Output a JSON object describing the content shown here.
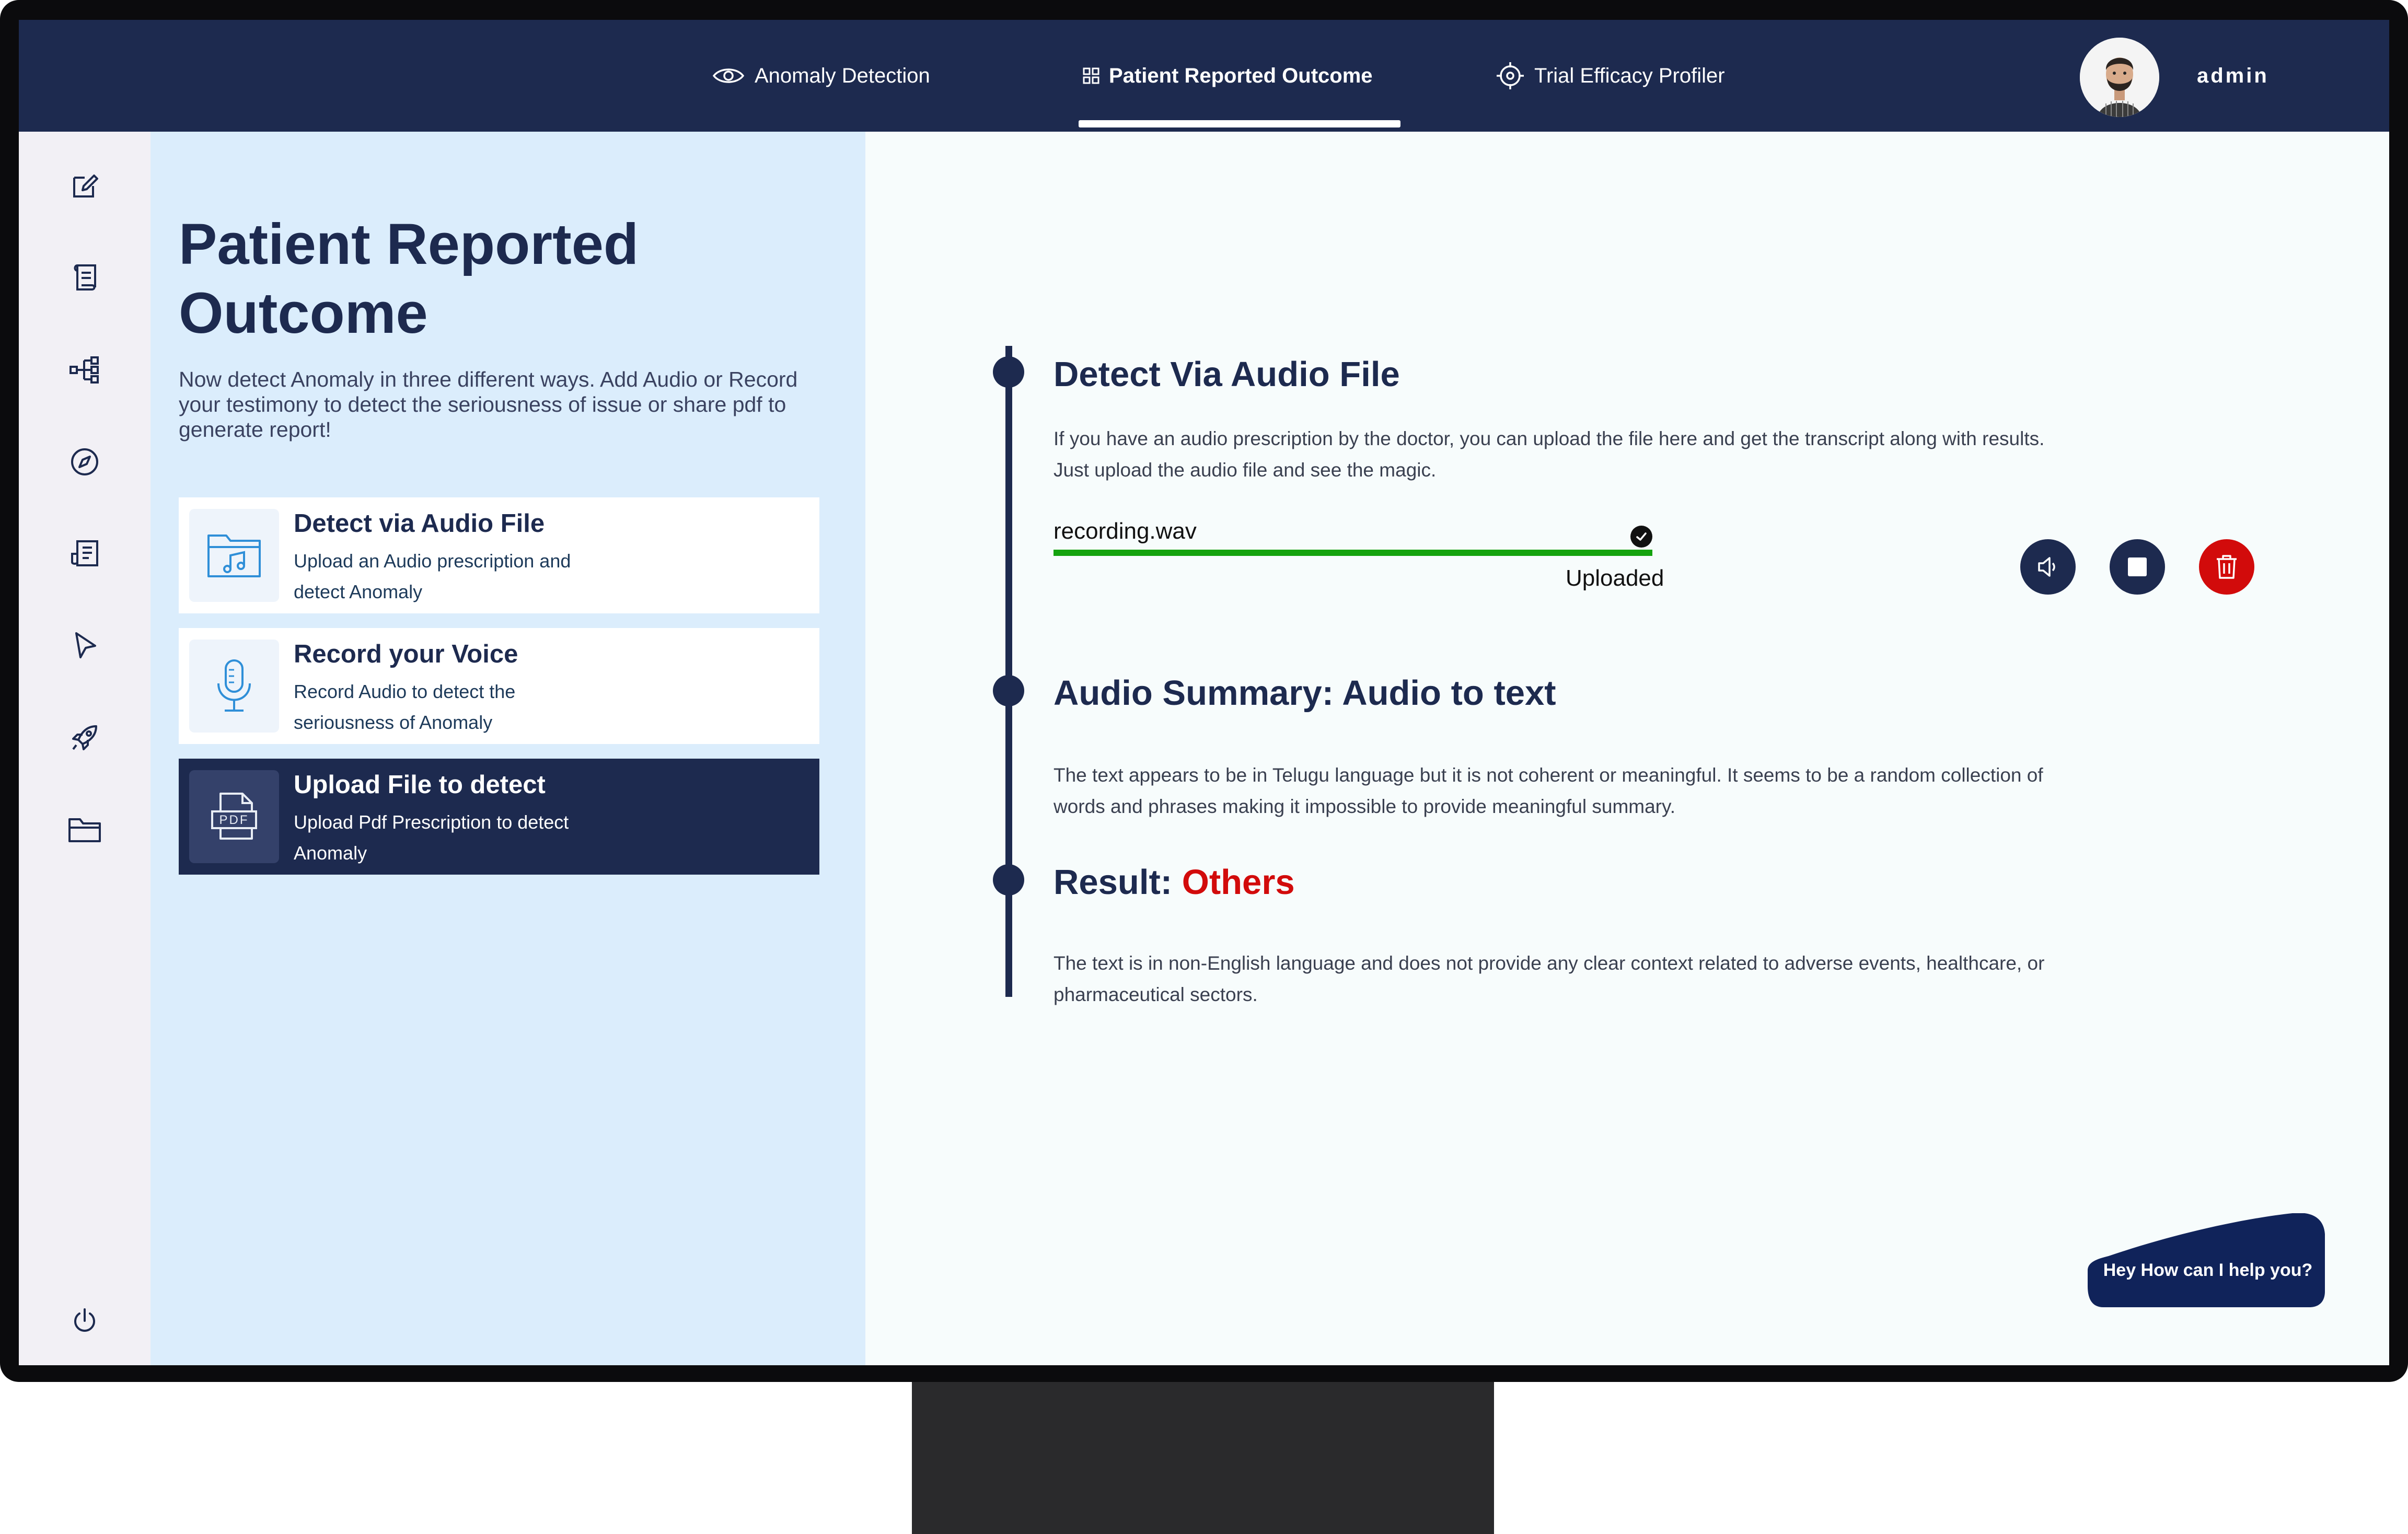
{
  "nav": {
    "tabs": [
      {
        "label": "Anomaly Detection",
        "icon": "eye-icon"
      },
      {
        "label": "Patient Reported Outcome",
        "icon": "grid-icon",
        "active": true
      },
      {
        "label": "Trial Efficacy Profiler",
        "icon": "crosshair-icon"
      }
    ],
    "user": {
      "name": "admin",
      "avatar": "avatar"
    }
  },
  "sidebar": {
    "icons": [
      "edit-icon",
      "scroll-icon",
      "hierarchy-icon",
      "compass-icon",
      "document-icon",
      "cursor-icon",
      "rocket-icon",
      "folder-icon",
      "power-icon"
    ]
  },
  "panel": {
    "title": "Patient Reported Outcome",
    "description": "Now detect Anomaly in three different ways. Add Audio or Record your testimony to detect the seriousness of issue or share pdf to generate report!",
    "options": [
      {
        "title": "Detect via Audio File",
        "description": "Upload an Audio prescription and detect Anomaly",
        "icon": "music-folder-icon",
        "selected": false
      },
      {
        "title": "Record your Voice",
        "description": "Record Audio to detect the seriousness of Anomaly",
        "icon": "microphone-icon",
        "selected": false
      },
      {
        "title": "Upload File to detect",
        "description": "Upload Pdf Prescription to detect Anomaly",
        "icon": "pdf-icon",
        "icon_text": "PDF",
        "selected": true
      }
    ]
  },
  "main": {
    "detect": {
      "title": "Detect Via Audio File",
      "description": "If you have an audio prescription by the doctor, you can upload the file here and get the transcript along with results. Just upload the audio file and see the magic."
    },
    "upload": {
      "file_name": "recording.wav",
      "status": "Uploaded",
      "progress": 100,
      "progress_color": "#15a30f"
    },
    "controls": [
      {
        "name": "speaker-button",
        "icon": "speaker-icon"
      },
      {
        "name": "stop-button",
        "icon": "stop-icon"
      },
      {
        "name": "delete-button",
        "icon": "trash-icon"
      }
    ],
    "summary": {
      "title": "Audio Summary: Audio to text",
      "text": "The text appears to be in Telugu language but it is not coherent or meaningful. It seems to be a random collection  of words and phrases making it impossible to provide  meaningful summary."
    },
    "result": {
      "label": "Result: ",
      "value": "Others",
      "value_color": "#d20b0b",
      "text": "The text is in  non-English language and does not provide any clear context related to adverse events, healthcare, or pharmaceutical sectors."
    }
  },
  "chat": {
    "label": "Hey How can I help you?"
  },
  "colors": {
    "navy": "#1d2a4f",
    "panel": "#dbedfc",
    "accent_red": "#d20b0b",
    "success_green": "#15a30f"
  }
}
